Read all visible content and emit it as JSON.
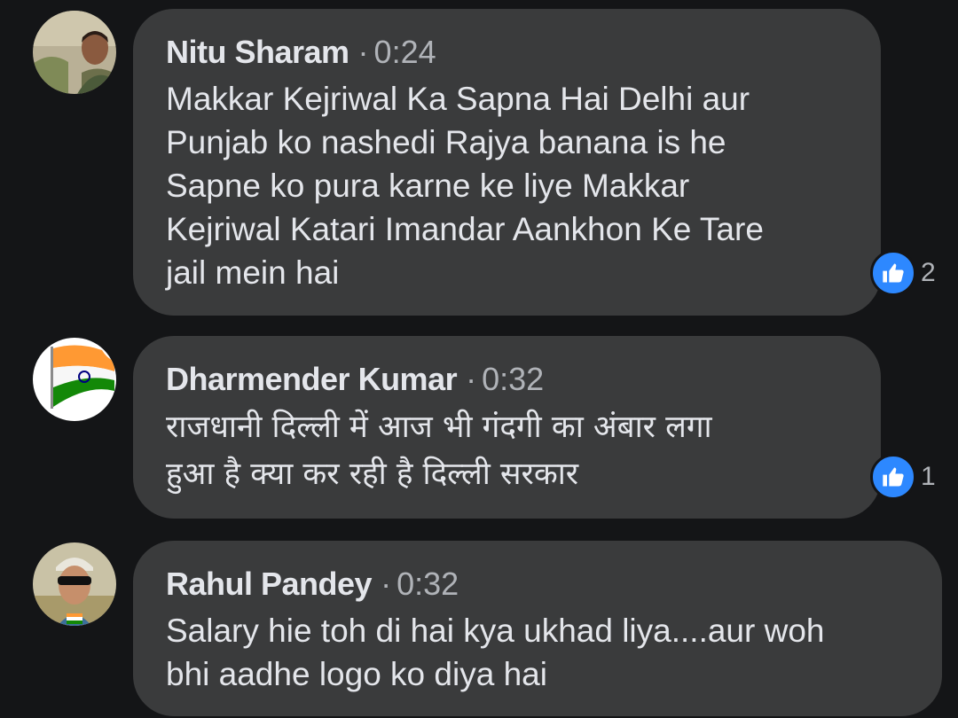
{
  "comments": [
    {
      "author": "Nitu Sharam",
      "separator": "·",
      "time": "0:24",
      "text": "Makkar Kejriwal Ka Sapna Hai Delhi aur\nPunjab ko nashedi Rajya banana is he\nSapne ko pura karne ke liye Makkar\nKejriwal Katari Imandar Aankhon Ke Tare\njail mein hai",
      "reaction_icon": "thumbs-up-icon",
      "reaction_count": "2"
    },
    {
      "author": "Dharmender Kumar",
      "separator": "·",
      "time": "0:32",
      "text": "राजधानी दिल्ली में आज भी गंदगी का अंबार लगा\nहुआ है क्या कर रही है दिल्ली सरकार",
      "reaction_icon": "thumbs-up-icon",
      "reaction_count": "1"
    },
    {
      "author": "Rahul Pandey",
      "separator": "·",
      "time": "0:32",
      "text": "Salary hie toh di hai kya ukhad liya....aur woh\nbhi aadhe logo ko diya hai"
    }
  ],
  "colors": {
    "background": "#141517",
    "bubble": "#3a3b3c",
    "primary_text": "#e4e6eb",
    "secondary_text": "#b0b3b8",
    "like_blue": "#2d88ff"
  }
}
